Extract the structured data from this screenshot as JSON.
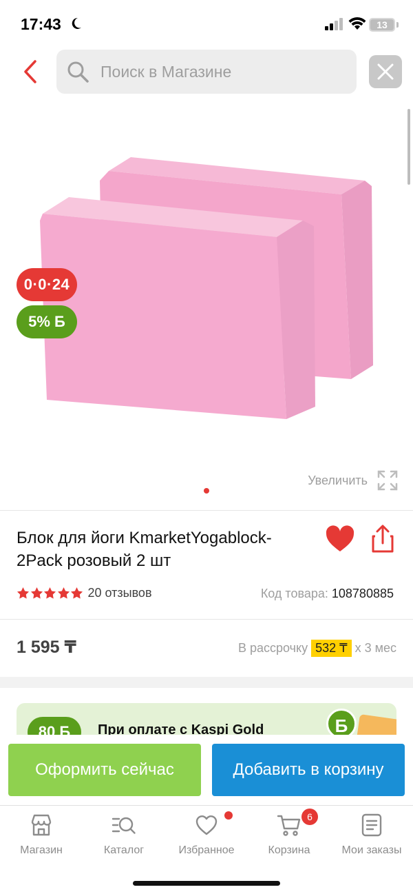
{
  "status_bar": {
    "time": "17:43",
    "battery": "13"
  },
  "search": {
    "placeholder": "Поиск в Магазине"
  },
  "gallery": {
    "badges": {
      "installment": "0·0·24",
      "bonus": "5% Б"
    },
    "zoom_label": "Увеличить"
  },
  "product": {
    "title": "Блок для йоги KmarketYogablock-2Pack розовый 2 шт",
    "reviews": "20 отзывов",
    "rating": 5,
    "sku_label": "Код товара:",
    "sku_value": "108780885",
    "price": "1 595 ₸",
    "credit_prefix": "В рассрочку",
    "credit_amount": "532 ₸",
    "credit_suffix": "х 3 мес"
  },
  "promo": {
    "badge": "80 Б",
    "text": "При оплате с Kaspi Gold",
    "coin": "Б"
  },
  "actions": {
    "checkout": "Оформить сейчас",
    "add_to_cart": "Добавить в корзину"
  },
  "tabbar": {
    "items": [
      {
        "label": "Магазин"
      },
      {
        "label": "Каталог"
      },
      {
        "label": "Избранное"
      },
      {
        "label": "Корзина",
        "badge": "6"
      },
      {
        "label": "Мои заказы"
      }
    ]
  },
  "colors": {
    "accent_red": "#e53935",
    "bonus_green": "#5a9e1c",
    "cart_blue": "#1a8fd6",
    "checkout_green": "#8fd14f",
    "credit_yellow": "#ffd000"
  }
}
